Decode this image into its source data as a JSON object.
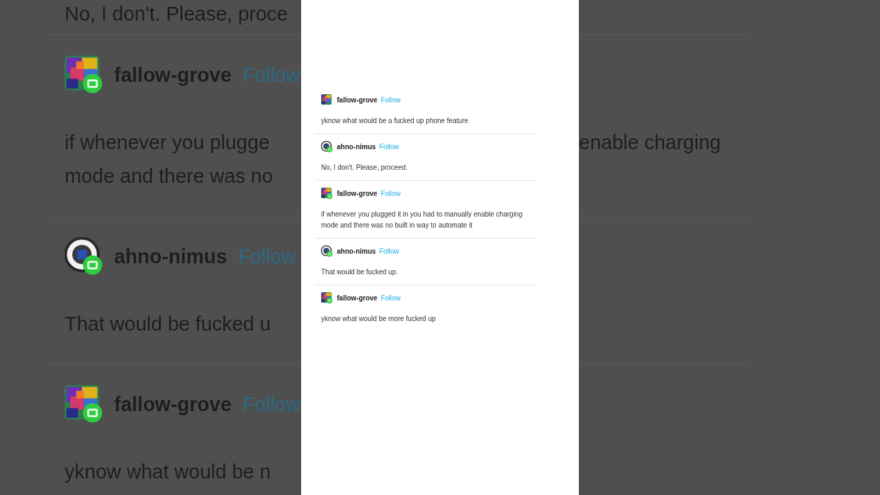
{
  "backdrop": {
    "top_line": "No, I don't. Please, proce",
    "blocks": [
      {
        "avatar": {
          "kind": "mosaic",
          "badge": true
        },
        "name": "fallow-grove",
        "follow": "Follow",
        "lines": [
          {
            "left": "if whenever you plugge",
            "right": "enable charging"
          },
          {
            "left": "mode and there was no"
          }
        ]
      },
      {
        "avatar": {
          "kind": "eye",
          "badge": true
        },
        "name": "ahno-nimus",
        "follow": "Follow",
        "lines": [
          {
            "left": "That would be fucked u"
          }
        ]
      },
      {
        "avatar": {
          "kind": "mosaic",
          "badge": true
        },
        "name": "fallow-grove",
        "follow": "Follow",
        "lines": [
          {
            "left": "yknow what would be n"
          }
        ]
      }
    ]
  },
  "thread": {
    "posts": [
      {
        "avatar": {
          "kind": "mosaic",
          "badge": false
        },
        "name": "fallow-grove",
        "follow": "Follow",
        "text": "yknow what would be a fucked up phone feature"
      },
      {
        "avatar": {
          "kind": "eye",
          "badge": true
        },
        "name": "ahno-nimus",
        "follow": "Follow",
        "text": "No, I don't. Please, proceed."
      },
      {
        "avatar": {
          "kind": "mosaic",
          "badge": true
        },
        "name": "fallow-grove",
        "follow": "Follow",
        "text": "if whenever you plugged it in you had to manually enable charging mode and there was no built in way to automate it"
      },
      {
        "avatar": {
          "kind": "eye",
          "badge": true
        },
        "name": "ahno-nimus",
        "follow": "Follow",
        "text": "That would be fucked up."
      },
      {
        "avatar": {
          "kind": "mosaic",
          "badge": true
        },
        "name": "fallow-grove",
        "follow": "Follow",
        "text": "yknow what would be more fucked up"
      }
    ]
  }
}
